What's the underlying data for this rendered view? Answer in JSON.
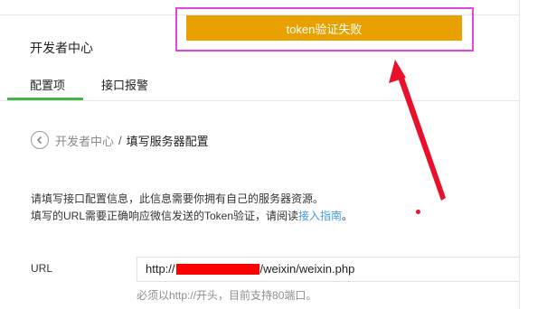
{
  "page": {
    "title": "开发者中心"
  },
  "tabs": [
    {
      "label": "配置项",
      "active": true
    },
    {
      "label": "接口报警",
      "active": false
    }
  ],
  "breadcrumb": {
    "parent": "开发者中心",
    "separator": "/",
    "current": "填写服务器配置"
  },
  "description": {
    "line1": "请填写接口配置信息，此信息需要你拥有自己的服务器资源。",
    "line2_prefix": "填写的URL需要正确响应微信发送的Token验证，请阅读",
    "line2_link": "接入指南",
    "line2_suffix": "。"
  },
  "url_field": {
    "label": "URL",
    "value_prefix": "http://",
    "value_suffix": "/weixin/weixin.php",
    "hint": "必须以http://开头，目前支持80端口。"
  },
  "toast": {
    "message": "token验证失败",
    "color": "#e9a100"
  },
  "annotation": {
    "highlight_color": "#e544e5",
    "arrow_color": "#e8102a"
  },
  "colors": {
    "tab_active": "#44b549",
    "link": "#459ae9"
  }
}
